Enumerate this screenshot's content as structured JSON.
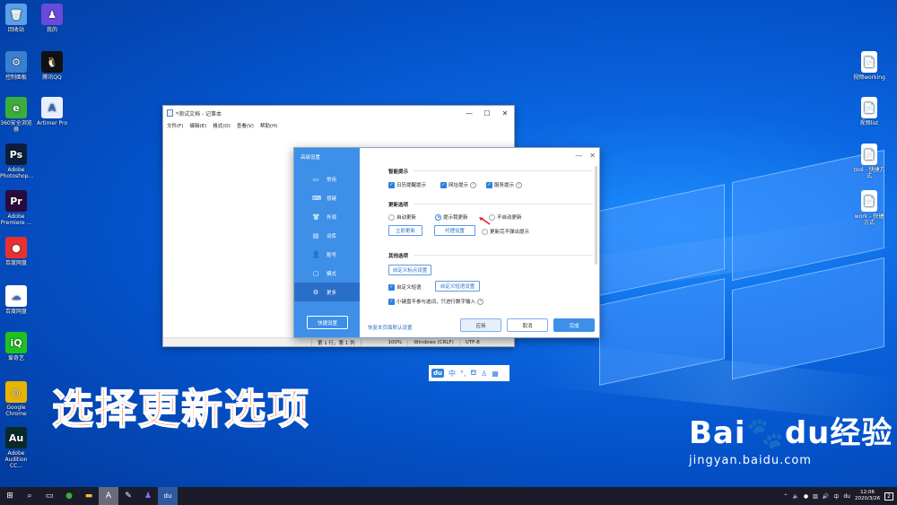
{
  "desktop": {
    "left_icons": [
      {
        "label": "回收站",
        "icon": "recycle-bin-icon",
        "color": "#5aa0e8",
        "glyph": "🗑"
      },
      {
        "label": "控制面板",
        "icon": "control-panel-icon",
        "color": "#3a7fd0",
        "glyph": "⚙"
      },
      {
        "label": "360安全浏览器",
        "icon": "browser-360-icon",
        "color": "#3aae3a",
        "glyph": "e"
      },
      {
        "label": "Adobe Photoshop...",
        "icon": "photoshop-icon",
        "color": "#0d1e3a",
        "glyph": "Ps"
      },
      {
        "label": "Adobe Premiere ...",
        "icon": "premiere-icon",
        "color": "#2a0a3a",
        "glyph": "Pr"
      },
      {
        "label": "百度网盘",
        "icon": "pepsi-icon",
        "color": "#e83030",
        "glyph": "●"
      },
      {
        "label": "百度网盘",
        "icon": "baidu-netdisk-icon",
        "color": "#ffffff",
        "glyph": "☁"
      },
      {
        "label": "爱奇艺",
        "icon": "iqiyi-icon",
        "color": "#1ec31e",
        "glyph": "iQ"
      },
      {
        "label": "Google Chrome",
        "icon": "chrome-icon",
        "color": "#e8b400",
        "glyph": "◎"
      },
      {
        "label": "Adobe Audition CC...",
        "icon": "audition-icon",
        "color": "#0a2a2a",
        "glyph": "Au"
      }
    ],
    "second_col_icons": [
      {
        "label": "我的",
        "icon": "user-app-icon",
        "color": "#6a4ad8",
        "glyph": "♟"
      },
      {
        "label": "腾讯QQ",
        "icon": "qq-icon",
        "color": "#111111",
        "glyph": "🐧"
      },
      {
        "label": "Artimer Pro",
        "icon": "artimer-icon",
        "color": "#e8f0ff",
        "glyph": "A"
      }
    ],
    "right_icons": [
      {
        "label": "视频working",
        "icon": "file-icon"
      },
      {
        "label": "视频list",
        "icon": "file-icon"
      },
      {
        "label": "tool - 快捷方式",
        "icon": "shortcut-icon"
      },
      {
        "label": "work - 快捷方式",
        "icon": "shortcut-icon"
      }
    ]
  },
  "notepad": {
    "title": "*测试文档 - 记事本",
    "menu": [
      "文件(F)",
      "编辑(E)",
      "格式(O)",
      "查看(V)",
      "帮助(H)"
    ],
    "status": {
      "position": "第 1 行，第 1 列",
      "zoom": "100%",
      "eol": "Windows (CRLF)",
      "encoding": "UTF-8"
    }
  },
  "dialog": {
    "title": "高级设置",
    "sidebar": [
      {
        "label": "常用",
        "icon": "monitor-icon",
        "glyph": "▭"
      },
      {
        "label": "按键",
        "icon": "keyboard-icon",
        "glyph": "⌨"
      },
      {
        "label": "外观",
        "icon": "shirt-icon",
        "glyph": "👕"
      },
      {
        "label": "词库",
        "icon": "dictionary-icon",
        "glyph": "▤"
      },
      {
        "label": "账号",
        "icon": "account-icon",
        "glyph": "👤"
      },
      {
        "label": "模式",
        "icon": "mode-icon",
        "glyph": "▢"
      },
      {
        "label": "更多",
        "icon": "gear-icon",
        "glyph": "⚙"
      }
    ],
    "quick_settings": "快捷设置",
    "smart_hints": {
      "title": "智能提示",
      "items": [
        "日历提醒提示",
        "网址提示",
        "服务提示"
      ]
    },
    "update": {
      "title": "更新选项",
      "options": [
        "自动更新",
        "提示我更新",
        "不自动更新"
      ],
      "update_now": "立即更新",
      "proxy": "代理设置",
      "no_popup": "更新完不弹出提示"
    },
    "other": {
      "title": "其他选项",
      "custom_punct": "自定义标点设置",
      "custom_phrase": "自定义短语",
      "custom_phrase_btn": "自定义短语设置",
      "numpad": "小键盘不参与选词，只进行数字输入"
    },
    "restore_default": "恢复本页面默认设置",
    "apply": "应用",
    "cancel": "取消",
    "done": "完成"
  },
  "ime_bar": {
    "logo": "du",
    "mode": "中",
    "items": [
      "°,",
      "⛾",
      "♙",
      "▦"
    ]
  },
  "overlay_caption": "选择更新选项",
  "watermark": {
    "brand": "Bai🐾du经验",
    "url": "jingyan.baidu.com"
  },
  "taskbar": {
    "time": "12:06",
    "date": "2020/3/26",
    "lang": "中",
    "notif": "2"
  }
}
